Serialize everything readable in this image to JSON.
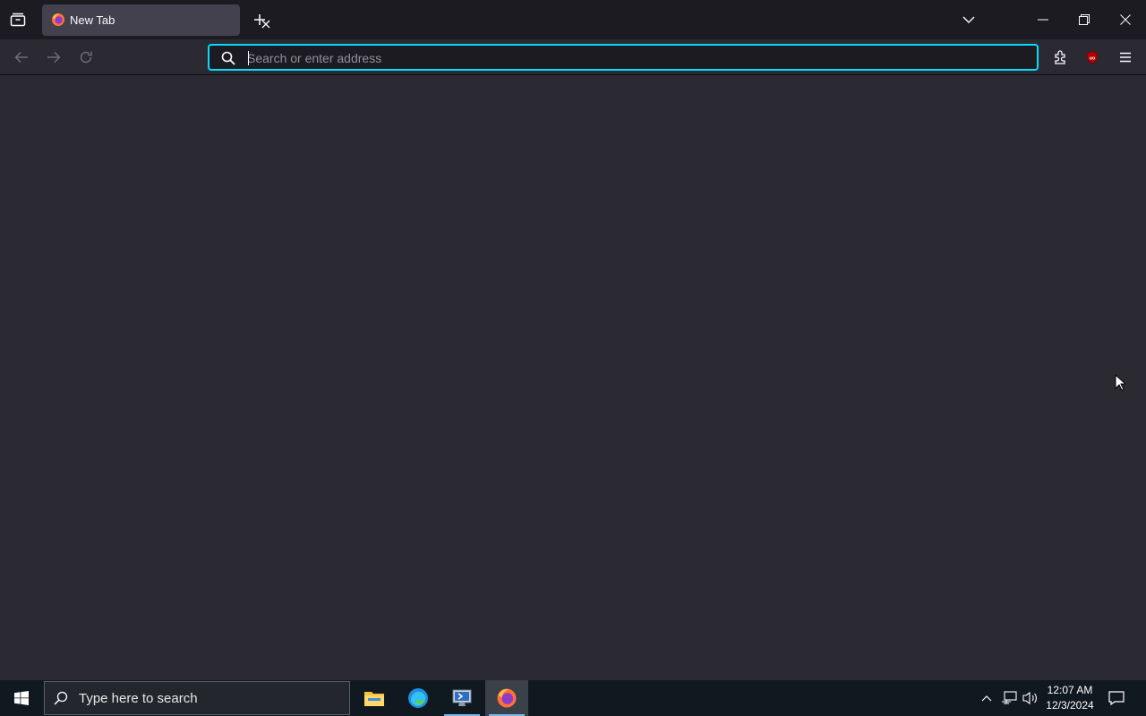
{
  "browser": {
    "tabs": [
      {
        "title": "New Tab",
        "active": true
      }
    ],
    "urlbar": {
      "placeholder": "Search or enter address",
      "value": ""
    },
    "accent_color": "#00ddff",
    "toolbar_icons": [
      "back-arrow-icon",
      "forward-arrow-icon",
      "reload-icon",
      "extensions-icon",
      "ublock-origin-icon",
      "hamburger-menu-icon"
    ]
  },
  "taskbar": {
    "search_placeholder": "Type here to search",
    "apps": [
      "file-explorer",
      "microsoft-edge",
      "remote-desktop",
      "firefox"
    ],
    "clock": {
      "time": "12:07 AM",
      "date": "12/3/2024"
    }
  }
}
